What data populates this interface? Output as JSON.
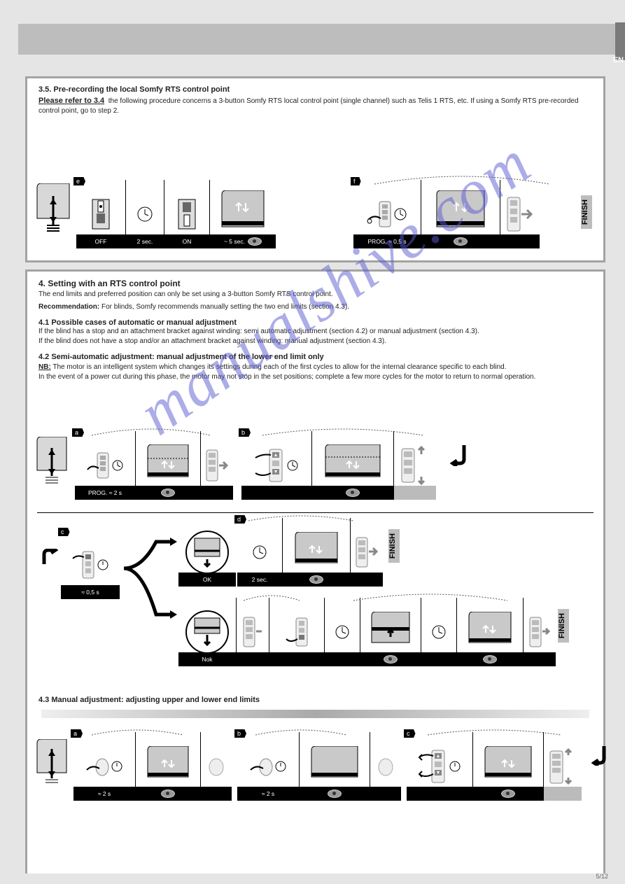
{
  "page": {
    "lang_tab": "EN",
    "page_num": "5/12"
  },
  "box1": {
    "title": "3.5. Pre-recording the local Somfy RTS control point",
    "intro_label": "Please refer to 3.4",
    "intro_text": "the following procedure concerns a 3-button Somfy RTS local control point (single channel) such as Telis 1 RTS, etc. If using a Somfy RTS pre-recorded control point, go to step 2.",
    "step_e": {
      "id": "e",
      "c1": "OFF",
      "c2": "2 sec.",
      "c3": "ON",
      "c4": "~ 5 sec."
    },
    "step_f": {
      "id": "f",
      "c1": "PROG. ≈ 0,5 s",
      "c2": ""
    },
    "finish": "FINISH"
  },
  "box2": {
    "title": "4. Setting with an RTS control point",
    "p1": "The end limits and preferred position can only be set using a 3-button Somfy RTS control point.",
    "recommend_label": "Recommendation:",
    "recommend_text": "For blinds, Somfy recommends manually setting the two end limits (section 4.3).",
    "s41_title": "4.1 Possible cases of automatic or manual adjustment",
    "s41_text": "If the blind has a stop and an attachment bracket against winding: semi automatic adjustment (section 4.2) or manual adjustment (section 4.3).\nIf the blind does not have a stop and/or an attachment bracket against winding: manual adjustment (section 4.3).",
    "s42_title": "4.2 Semi-automatic adjustment: manual adjustment of the lower end limit only",
    "note_label": "NB:",
    "note_text": "The motor is an intelligent system which changes its settings during each of the first cycles to allow for the internal clearance specific to each blind.",
    "note2": "In the event of a power cut during this phase, the motor may not stop in the set positions; complete a few more cycles for the motor to return to normal operation.",
    "step_a": {
      "id": "a",
      "c1": "PROG. ≈ 2 s"
    },
    "step_b": {
      "id": "b"
    },
    "step_c": {
      "id": "c",
      "c1": "≈ 0,5 s"
    },
    "step_d": {
      "id": "d",
      "extra": "2 sec."
    },
    "ok": "OK",
    "not_ok": "Nok",
    "finish": "FINISH",
    "s43_title": "4.3 Manual adjustment: adjusting upper and lower end limits",
    "step43_a": {
      "id": "a",
      "c1": "≈ 2 s"
    },
    "step43_b": {
      "id": "b",
      "c1": "≈ 2 s"
    },
    "step43_c": {
      "id": "c"
    }
  },
  "watermark": "manualshive.com"
}
